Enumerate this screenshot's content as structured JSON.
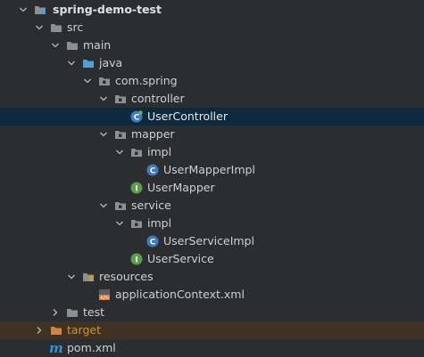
{
  "tree": {
    "root": "spring-demo-test",
    "src": "src",
    "main": "main",
    "java": "java",
    "package": "com.spring",
    "controller": "controller",
    "user_controller": "UserController",
    "mapper": "mapper",
    "mapper_impl": "impl",
    "user_mapper_impl": "UserMapperImpl",
    "user_mapper": "UserMapper",
    "service": "service",
    "service_impl": "impl",
    "user_service_impl": "UserServiceImpl",
    "user_service": "UserService",
    "resources": "resources",
    "app_context": "applicationContext.xml",
    "test": "test",
    "target": "target",
    "pom": "pom.xml",
    "pom_icon_letter": "m"
  },
  "icons": {
    "folder_color": "#8c9096",
    "source_folder_color": "#4f9fd8",
    "resources_color": "#c6a64b",
    "target_folder_color": "#d4843e",
    "class_icon_color": "#3d7cbf",
    "interface_icon_color": "#5e9c47",
    "xml_icon_color": "#d4843e"
  }
}
